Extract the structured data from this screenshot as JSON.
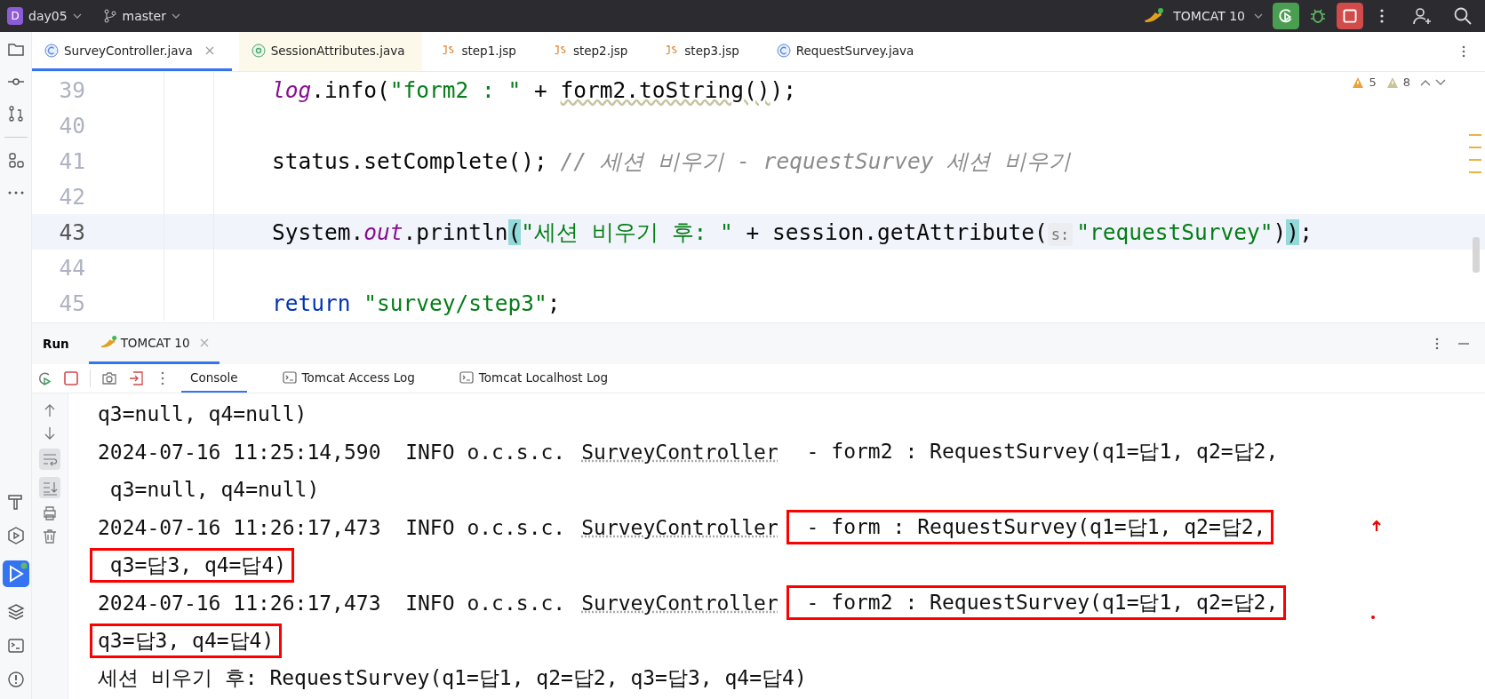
{
  "top_bar": {
    "project": {
      "badge": "D",
      "name": "day05"
    },
    "branch": "master",
    "run_config": "TOMCAT 10"
  },
  "editor_tabs": [
    {
      "label": "SurveyController.java",
      "kind": "class",
      "selected": true,
      "readonly": false
    },
    {
      "label": "SessionAttributes.java",
      "kind": "annotation",
      "selected": false,
      "readonly": true
    },
    {
      "label": "step1.jsp",
      "kind": "jsp",
      "selected": false,
      "readonly": false
    },
    {
      "label": "step2.jsp",
      "kind": "jsp",
      "selected": false,
      "readonly": false
    },
    {
      "label": "step3.jsp",
      "kind": "jsp",
      "selected": false,
      "readonly": false
    },
    {
      "label": "RequestSurvey.java",
      "kind": "class",
      "selected": false,
      "readonly": false
    }
  ],
  "editor": {
    "warnings": "5",
    "weak_warnings": "8",
    "lines": [
      {
        "number": "39",
        "current": false,
        "tokens": [
          {
            "kind": "field",
            "text": "log"
          },
          {
            "kind": "plain",
            "text": ".info("
          },
          {
            "kind": "string",
            "text": "\"form2 : \""
          },
          {
            "kind": "plain",
            "text": " + "
          },
          {
            "kind": "warned",
            "text": "form2.toString()"
          },
          {
            "kind": "plain",
            "text": ");"
          }
        ]
      },
      {
        "number": "40",
        "current": false
      },
      {
        "number": "41",
        "current": false,
        "tokens": [
          {
            "kind": "plain",
            "text": "status.setComplete(); "
          },
          {
            "kind": "comment",
            "text": "// 세션 비우기 - requestSurvey 세션 비우기"
          }
        ]
      },
      {
        "number": "42",
        "current": false
      },
      {
        "number": "43",
        "current": true,
        "tokens": [
          {
            "kind": "plain",
            "text": "System."
          },
          {
            "kind": "field",
            "text": "out"
          },
          {
            "kind": "plain",
            "text": ".println"
          },
          {
            "kind": "match",
            "text": "("
          },
          {
            "kind": "string",
            "text": "\"세션 비우기 후: \""
          },
          {
            "kind": "plain",
            "text": " + session.getAttribute("
          },
          {
            "kind": "hint",
            "text": "s:"
          },
          {
            "kind": "string",
            "text": "\"requestSurvey\""
          },
          {
            "kind": "plain",
            "text": ")"
          },
          {
            "kind": "match",
            "text": ")"
          },
          {
            "kind": "plain",
            "text": ";"
          }
        ]
      },
      {
        "number": "44",
        "current": false
      },
      {
        "number": "45",
        "current": false,
        "tokens": [
          {
            "kind": "keyword",
            "text": "return"
          },
          {
            "kind": "string",
            "text": "\"survey/step3\""
          },
          {
            "kind": "plain",
            "text": ";"
          }
        ]
      }
    ]
  },
  "run_panel": {
    "title": "Run",
    "tabs": [
      {
        "label": "TOMCAT 10",
        "selected": true
      }
    ],
    "sub_tabs": [
      {
        "label": "Console",
        "kind": "console",
        "selected": true
      },
      {
        "label": "Tomcat Access Log",
        "kind": "log",
        "selected": false
      },
      {
        "label": "Tomcat Localhost Log",
        "kind": "log",
        "selected": false
      }
    ],
    "console_lines": [
      {
        "segments": [
          {
            "text": "q3=null, q4=null)",
            "underlined": false,
            "boxed": false
          }
        ]
      },
      {
        "segments": [
          {
            "text": "2024-07-16 11:25:14,590  INFO o.c.s.c.",
            "underlined": false,
            "boxed": false
          },
          {
            "text": "SurveyController",
            "underlined": true,
            "boxed": false
          },
          {
            "text": " - form2 : RequestSurvey(q1=답1, q2=답2,",
            "underlined": false,
            "boxed": false
          }
        ]
      },
      {
        "segments": [
          {
            "text": " q3=null, q4=null)",
            "underlined": false,
            "boxed": false
          }
        ]
      },
      {
        "segments": [
          {
            "text": "2024-07-16 11:26:17,473  INFO o.c.s.c.",
            "underlined": false,
            "boxed": false
          },
          {
            "text": "SurveyController",
            "underlined": true,
            "boxed": false
          },
          {
            "text": " - form : RequestSurvey(q1=답1, q2=답2,",
            "underlined": false,
            "boxed": true
          }
        ]
      },
      {
        "segments": [
          {
            "text": " q3=답3, q4=답4)",
            "underlined": false,
            "boxed": true
          }
        ]
      },
      {
        "segments": [
          {
            "text": "2024-07-16 11:26:17,473  INFO o.c.s.c.",
            "underlined": false,
            "boxed": false
          },
          {
            "text": "SurveyController",
            "underlined": true,
            "boxed": false
          },
          {
            "text": " - form2 : RequestSurvey(q1=답1, q2=답2,",
            "underlined": false,
            "boxed": true
          }
        ]
      },
      {
        "segments": [
          {
            "text": "q3=답3, q4=답4)",
            "underlined": false,
            "boxed": true
          }
        ]
      },
      {
        "segments": [
          {
            "text": "세션 비우기 후: RequestSurvey(q1=답1, q2=답2, q3=답3, q4=답4)",
            "underlined": false,
            "boxed": false
          }
        ]
      }
    ]
  }
}
